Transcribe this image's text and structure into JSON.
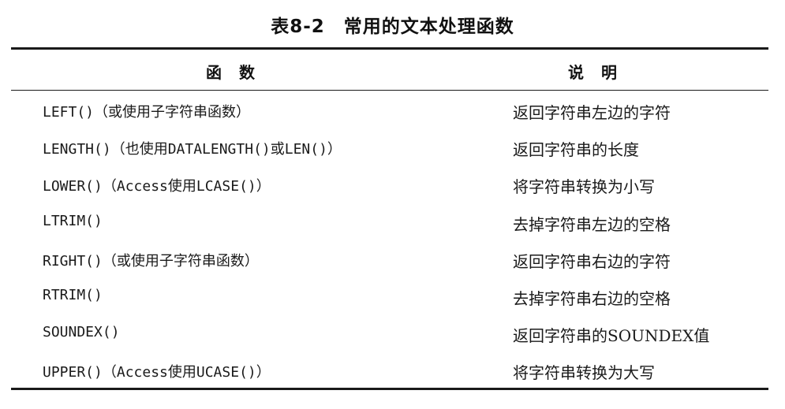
{
  "caption": "表8-2　常用的文本处理函数",
  "header": {
    "function": "函数",
    "description": "说明"
  },
  "rows": [
    {
      "function": "LEFT()（或使用子字符串函数）",
      "description": "返回字符串左边的字符"
    },
    {
      "function": "LENGTH()（也使用DATALENGTH()或LEN()）",
      "description": "返回字符串的长度"
    },
    {
      "function": "LOWER()（Access使用LCASE()）",
      "description": "将字符串转换为小写"
    },
    {
      "function": "LTRIM()",
      "description": "去掉字符串左边的空格"
    },
    {
      "function": "RIGHT()（或使用子字符串函数）",
      "description": "返回字符串右边的字符"
    },
    {
      "function": "RTRIM()",
      "description": "去掉字符串右边的空格"
    },
    {
      "function": "SOUNDEX()",
      "description": "返回字符串的SOUNDEX值"
    },
    {
      "function": "UPPER()（Access使用UCASE()）",
      "description": "将字符串转换为大写"
    }
  ]
}
